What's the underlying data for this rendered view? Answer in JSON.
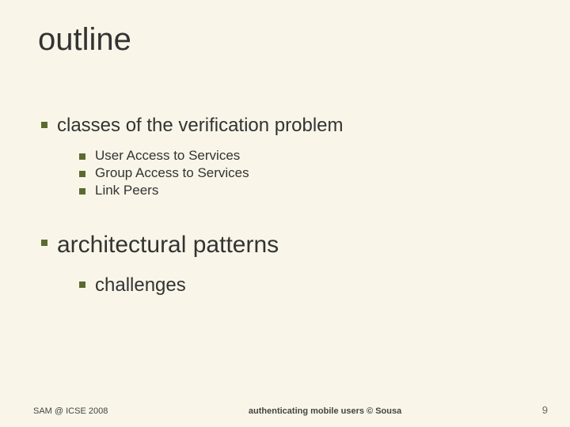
{
  "title": "outline",
  "item1": {
    "label": "classes of the verification problem",
    "subs": [
      "User Access to Services",
      "Group Access to Services",
      "Link Peers"
    ]
  },
  "item2": {
    "label": "architectural patterns",
    "subs": [
      "challenges"
    ]
  },
  "footer": {
    "left": "SAM @ ICSE 2008",
    "center": "authenticating mobile users © Sousa",
    "right": "9"
  }
}
